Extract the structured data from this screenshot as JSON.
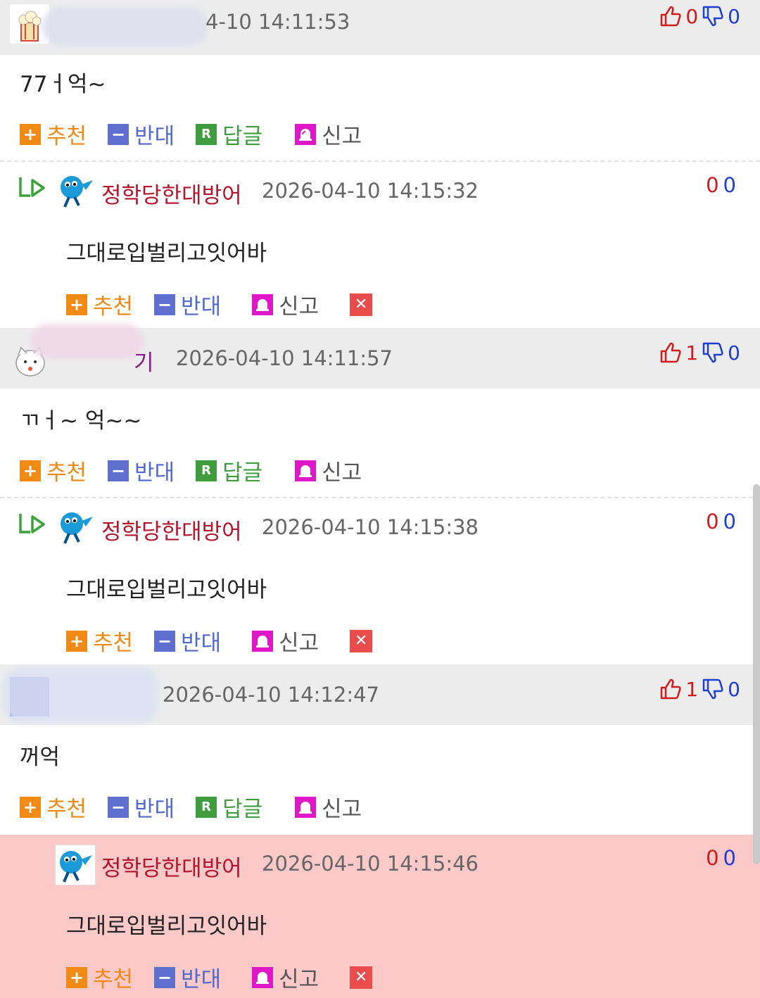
{
  "comments": [
    {
      "timestamp": "4-10 14:11:53",
      "up": "0",
      "down": "0",
      "body": "77ㅓ억~",
      "actions": {
        "recommend": "추천",
        "oppose": "반대",
        "reply": "답글",
        "report": "신고"
      },
      "reply": {
        "name": "정학당한대방어",
        "timestamp": "2026-04-10 14:15:32",
        "up": "0",
        "down": "0",
        "body": "그대로입벌리고잇어바",
        "actions": {
          "recommend": "추천",
          "oppose": "반대",
          "report": "신고"
        }
      }
    },
    {
      "name_fragment": "기",
      "timestamp": "2026-04-10 14:11:57",
      "up": "1",
      "down": "0",
      "body": "ㄲㅓ~ 억~~",
      "actions": {
        "recommend": "추천",
        "oppose": "반대",
        "reply": "답글",
        "report": "신고"
      },
      "reply": {
        "name": "정학당한대방어",
        "timestamp": "2026-04-10 14:15:38",
        "up": "0",
        "down": "0",
        "body": "그대로입벌리고잇어바",
        "actions": {
          "recommend": "추천",
          "oppose": "반대",
          "report": "신고"
        }
      }
    },
    {
      "timestamp": "2026-04-10 14:12:47",
      "up": "1",
      "down": "0",
      "body": "꺼억",
      "actions": {
        "recommend": "추천",
        "oppose": "반대",
        "reply": "답글",
        "report": "신고"
      },
      "reply": {
        "name": "정학당한대방어",
        "timestamp": "2026-04-10 14:15:46",
        "up": "0",
        "down": "0",
        "body": "그대로입벌리고잇어바",
        "actions": {
          "recommend": "추천",
          "oppose": "반대",
          "report": "신고"
        }
      }
    }
  ],
  "icons": {
    "thumbs_up": "thumbs-up-icon",
    "thumbs_down": "thumbs-down-icon",
    "recommend": "plus-icon",
    "oppose": "minus-icon",
    "reply": "reply-r-icon",
    "report": "siren-icon",
    "delete": "close-icon"
  },
  "colors": {
    "header_bg": "#ececec",
    "highlight_bg": "#fcc8c8",
    "recommend": "#f08a15",
    "oppose": "#5f6fcf",
    "reply": "#3f9d3f",
    "report": "#e017c8",
    "delete": "#ea4b4b",
    "reply_name": "#b3142c"
  }
}
